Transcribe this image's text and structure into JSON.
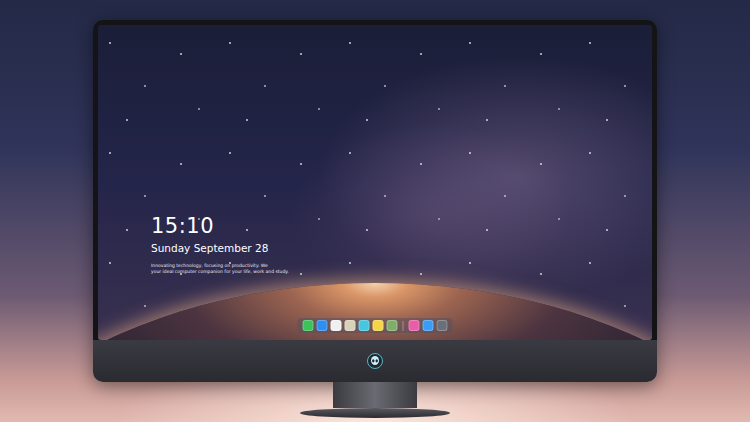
{
  "screen": {
    "time": "15:10",
    "date": "Sunday September 28",
    "caption": [
      "Innovating technology, focusing on productivity. We",
      "your ideal computer companion for your life, work and study."
    ]
  },
  "dock": {
    "items": [
      {
        "color": "#3bc25a"
      },
      {
        "color": "#2f8ef0"
      },
      {
        "color": "#f0f0f0"
      },
      {
        "color": "#d8d2b8"
      },
      {
        "color": "#46c6e0"
      },
      {
        "color": "#f5d547"
      },
      {
        "color": "#7fae6a"
      },
      {
        "color": "#e95ca8"
      },
      {
        "color": "#3a9cf5"
      },
      {
        "color": "#6b6f78"
      }
    ]
  }
}
